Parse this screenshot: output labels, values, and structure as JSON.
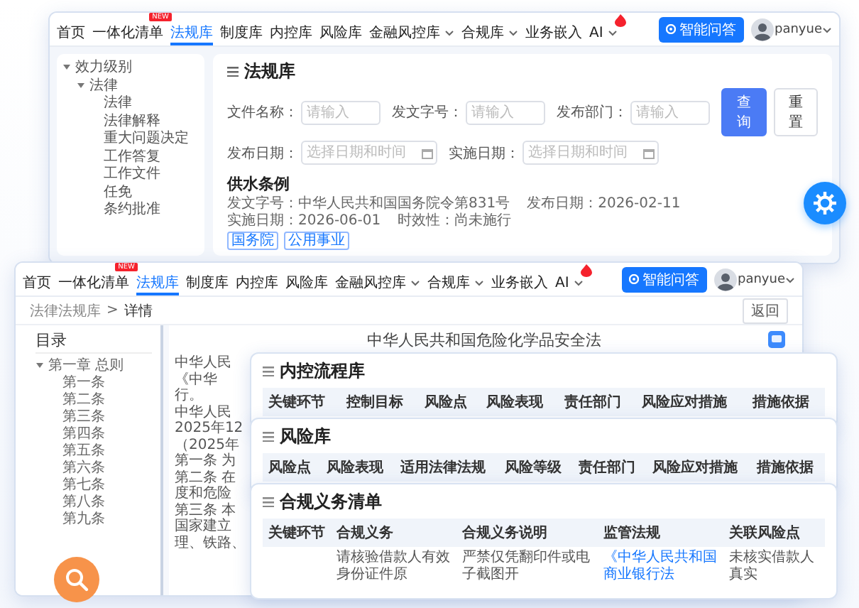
{
  "law_list_window": {
    "nav": {
      "items": [
        {
          "label": "首页",
          "selected": false,
          "dropdown": false,
          "hot": false
        },
        {
          "label": "一体化清单",
          "selected": false,
          "dropdown": false,
          "hot": false,
          "badge": "NEW"
        },
        {
          "label": "法规库",
          "selected": true,
          "dropdown": false,
          "hot": false
        },
        {
          "label": "制度库",
          "selected": false,
          "dropdown": false,
          "hot": false
        },
        {
          "label": "内控库",
          "selected": false,
          "dropdown": false,
          "hot": false
        },
        {
          "label": "风险库",
          "selected": false,
          "dropdown": false,
          "hot": false
        },
        {
          "label": "金融风控库",
          "selected": false,
          "dropdown": true,
          "hot": false
        },
        {
          "label": "合规库",
          "selected": false,
          "dropdown": true,
          "hot": false
        },
        {
          "label": "业务嵌入",
          "selected": false,
          "dropdown": false,
          "hot": false
        },
        {
          "label": "AI",
          "selected": false,
          "dropdown": true,
          "hot": true
        }
      ],
      "assistant_button": "智能问答",
      "user": "panyue"
    },
    "tree": [
      {
        "label": "效力级别",
        "expanded": true,
        "children": [
          {
            "label": "法律",
            "expanded": true,
            "children": [
              {
                "label": "法律"
              },
              {
                "label": "法律解释"
              },
              {
                "label": "重大问题决定"
              },
              {
                "label": "工作答复"
              },
              {
                "label": "工作文件"
              },
              {
                "label": "任免"
              },
              {
                "label": "条约批准"
              }
            ]
          }
        ]
      }
    ],
    "panel": {
      "title": "法规库",
      "filters": [
        {
          "label": "文件名称：",
          "placeholder": "请输入",
          "kind": "text"
        },
        {
          "label": "发文字号：",
          "placeholder": "请输入",
          "kind": "text"
        },
        {
          "label": "发布部门：",
          "placeholder": "请输入",
          "kind": "text"
        },
        {
          "label": "发布日期：",
          "placeholder": "选择日期和时间",
          "kind": "date"
        },
        {
          "label": "实施日期：",
          "placeholder": "选择日期和时间",
          "kind": "date"
        }
      ],
      "buttons": [
        {
          "label": "查询",
          "kind": "primary"
        },
        {
          "label": "重置",
          "kind": "default"
        }
      ],
      "results": [
        {
          "title": "供水条例",
          "meta": [
            "发文字号：中华人民共和国国务院令第831号",
            "发布日期：2026-02-11",
            "实施日期：2026-06-01",
            "时效性：尚未施行"
          ],
          "tags": [
            "国务院",
            "公用事业"
          ]
        }
      ]
    }
  },
  "detail_window": {
    "nav": {
      "items": [
        {
          "label": "首页",
          "selected": false,
          "dropdown": false,
          "hot": false
        },
        {
          "label": "一体化清单",
          "selected": false,
          "dropdown": false,
          "hot": false,
          "badge": "NEW"
        },
        {
          "label": "法规库",
          "selected": true,
          "dropdown": false,
          "hot": false
        },
        {
          "label": "制度库",
          "selected": false,
          "dropdown": false,
          "hot": false
        },
        {
          "label": "内控库",
          "selected": false,
          "dropdown": false,
          "hot": false
        },
        {
          "label": "风险库",
          "selected": false,
          "dropdown": false,
          "hot": false
        },
        {
          "label": "金融风控库",
          "selected": false,
          "dropdown": true,
          "hot": false
        },
        {
          "label": "合规库",
          "selected": false,
          "dropdown": true,
          "hot": false
        },
        {
          "label": "业务嵌入",
          "selected": false,
          "dropdown": false,
          "hot": false
        },
        {
          "label": "AI",
          "selected": false,
          "dropdown": true,
          "hot": true
        }
      ],
      "assistant_button": "智能问答",
      "user": "panyue"
    },
    "breadcrumb": {
      "items": [
        "法律法规库",
        "详情"
      ],
      "separator": ">"
    },
    "back_button": "返回",
    "toc": {
      "title": "目录",
      "items": [
        {
          "label": "第一章 总则",
          "expanded": true,
          "children": [
            {
              "label": "第一条"
            },
            {
              "label": "第二条"
            },
            {
              "label": "第三条"
            },
            {
              "label": "第四条"
            },
            {
              "label": "第五条"
            },
            {
              "label": "第六条"
            },
            {
              "label": "第七条"
            },
            {
              "label": "第八条"
            },
            {
              "label": "第九条"
            }
          ]
        }
      ]
    },
    "document": {
      "title": "中华人民共和国危险化学品安全法",
      "lines": [
        "中华人民",
        "《中华",
        "行。",
        "中华人民",
        "2025年12",
        "（2025年",
        "第一条 为",
        "第二条 在",
        "度和危险",
        "第三条 本",
        "国家建立",
        "理、铁路、"
      ]
    }
  },
  "cards": [
    {
      "title": "内控流程库",
      "columns": [
        "关键环节",
        "控制目标",
        "风险点",
        "风险表现",
        "责任部门",
        "风险应对措施",
        "措施依据"
      ]
    },
    {
      "title": "风险库",
      "columns": [
        "风险点",
        "风险表现",
        "适用法律法规",
        "风险等级",
        "责任部门",
        "风险应对措施",
        "措施依据"
      ]
    },
    {
      "title": "合规义务清单",
      "columns": [
        "关键环节",
        "合规义务",
        "合规义务说明",
        "监管法规",
        "关联风险点"
      ],
      "rows": [
        {
          "cells": [
            null,
            {
              "text": "请核验借款人有效身份证件原",
              "kind": "text"
            },
            {
              "text": "严禁仅凭翻印件或电子截图开",
              "kind": "text"
            },
            {
              "text": "《中华人民共和国商业银行法",
              "kind": "link"
            },
            {
              "text": "未核实借款人真实",
              "kind": "text"
            }
          ]
        }
      ]
    }
  ]
}
